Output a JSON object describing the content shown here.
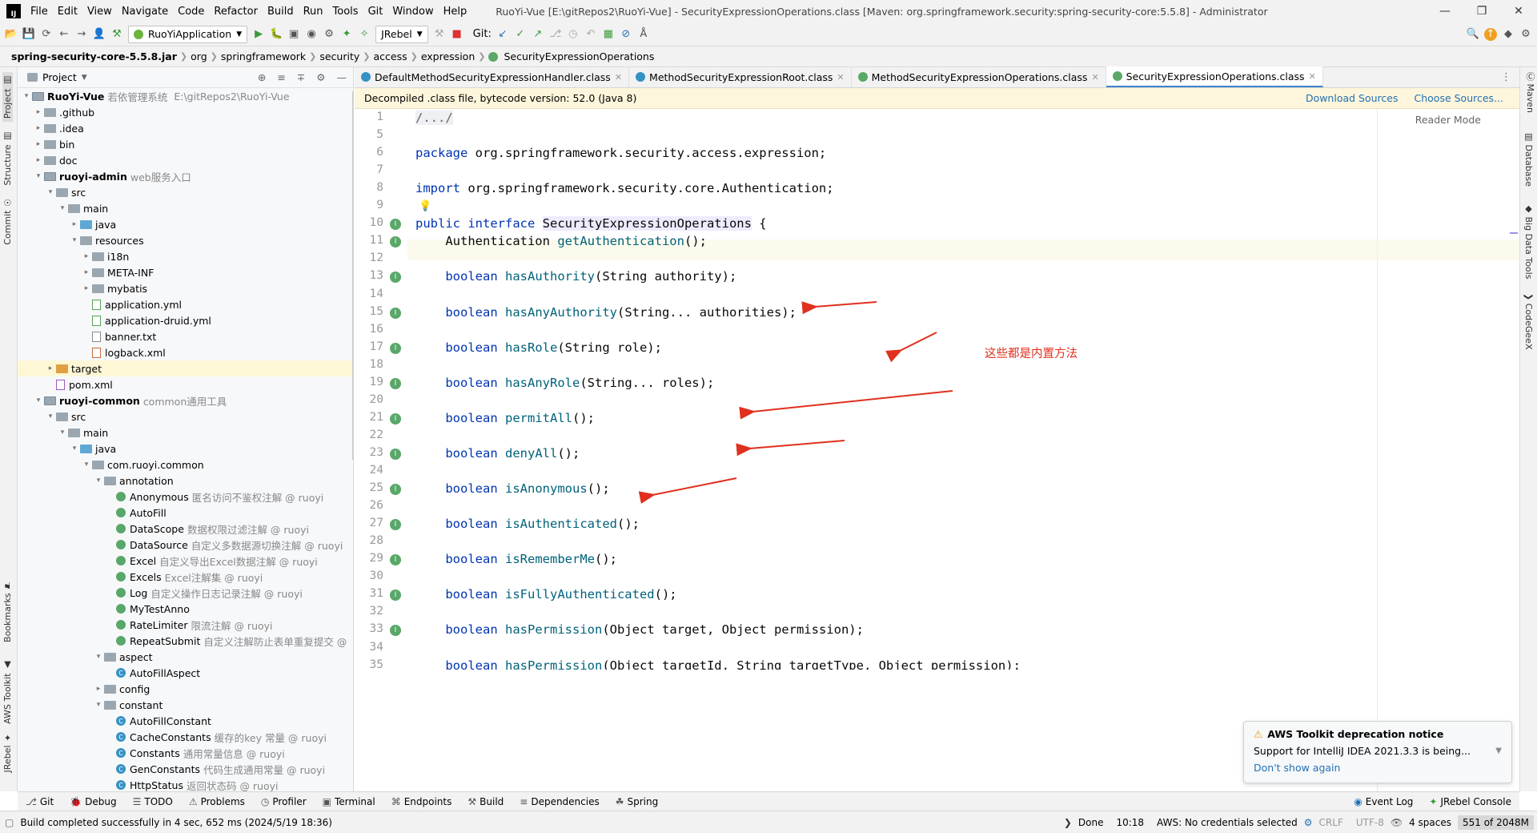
{
  "menu": {
    "logo": "IJ",
    "items": [
      "File",
      "Edit",
      "View",
      "Navigate",
      "Code",
      "Refactor",
      "Build",
      "Run",
      "Tools",
      "Git",
      "Window",
      "Help"
    ],
    "title": "RuoYi-Vue [E:\\gitRepos2\\RuoYi-Vue] - SecurityExpressionOperations.class [Maven: org.springframework.security:spring-security-core:5.5.8] - Administrator"
  },
  "toolbar": {
    "run_config": "RuoYiApplication",
    "jrebel": "JRebel",
    "git_label": "Git:"
  },
  "breadcrumb": [
    "spring-security-core-5.5.8.jar",
    "org",
    "springframework",
    "security",
    "access",
    "expression",
    "SecurityExpressionOperations"
  ],
  "left_strip": [
    "Project",
    "Structure",
    "Commit",
    "Bookmarks",
    "AWS Toolkit",
    "JRebel"
  ],
  "right_strip": [
    "Maven",
    "Database",
    "Big Data Tools",
    "CodeGeeX"
  ],
  "project": {
    "header": "Project",
    "tree": [
      {
        "label": "RuoYi-Vue",
        "note": "若依管理系统",
        "path": "E:\\gitRepos2\\RuoYi-Vue",
        "indent": 0,
        "arrow": "v",
        "icon": "mod",
        "bold": true
      },
      {
        "label": ".github",
        "indent": 1,
        "arrow": ">",
        "icon": "folder"
      },
      {
        "label": ".idea",
        "indent": 1,
        "arrow": ">",
        "icon": "folder"
      },
      {
        "label": "bin",
        "indent": 1,
        "arrow": ">",
        "icon": "folder"
      },
      {
        "label": "doc",
        "indent": 1,
        "arrow": ">",
        "icon": "folder"
      },
      {
        "label": "ruoyi-admin",
        "note": "web服务入口",
        "indent": 1,
        "arrow": "v",
        "icon": "mod",
        "bold": true
      },
      {
        "label": "src",
        "indent": 2,
        "arrow": "v",
        "icon": "folder"
      },
      {
        "label": "main",
        "indent": 3,
        "arrow": "v",
        "icon": "folder"
      },
      {
        "label": "java",
        "indent": 4,
        "arrow": ">",
        "icon": "blue"
      },
      {
        "label": "resources",
        "indent": 4,
        "arrow": "v",
        "icon": "folder"
      },
      {
        "label": "i18n",
        "indent": 5,
        "arrow": ">",
        "icon": "folder"
      },
      {
        "label": "META-INF",
        "indent": 5,
        "arrow": ">",
        "icon": "folder"
      },
      {
        "label": "mybatis",
        "indent": 5,
        "arrow": ">",
        "icon": "folder"
      },
      {
        "label": "application.yml",
        "indent": 5,
        "arrow": "",
        "icon": "yml"
      },
      {
        "label": "application-druid.yml",
        "indent": 5,
        "arrow": "",
        "icon": "yml"
      },
      {
        "label": "banner.txt",
        "indent": 5,
        "arrow": "",
        "icon": "txt"
      },
      {
        "label": "logback.xml",
        "indent": 5,
        "arrow": "",
        "icon": "xml"
      },
      {
        "label": "target",
        "indent": 2,
        "arrow": ">",
        "icon": "orange",
        "selected": true
      },
      {
        "label": "pom.xml",
        "indent": 2,
        "arrow": "",
        "icon": "pom"
      },
      {
        "label": "ruoyi-common",
        "note": "common通用工具",
        "indent": 1,
        "arrow": "v",
        "icon": "mod",
        "bold": true
      },
      {
        "label": "src",
        "indent": 2,
        "arrow": "v",
        "icon": "folder"
      },
      {
        "label": "main",
        "indent": 3,
        "arrow": "v",
        "icon": "folder"
      },
      {
        "label": "java",
        "indent": 4,
        "arrow": "v",
        "icon": "blue"
      },
      {
        "label": "com.ruoyi.common",
        "indent": 5,
        "arrow": "v",
        "icon": "folder"
      },
      {
        "label": "annotation",
        "indent": 6,
        "arrow": "v",
        "icon": "folder"
      },
      {
        "label": "Anonymous",
        "note": "匿名访问不鉴权注解 @ ruoyi",
        "indent": 7,
        "arrow": "",
        "icon": "annot"
      },
      {
        "label": "AutoFill",
        "indent": 7,
        "arrow": "",
        "icon": "annot"
      },
      {
        "label": "DataScope",
        "note": "数据权限过滤注解 @ ruoyi",
        "indent": 7,
        "arrow": "",
        "icon": "annot"
      },
      {
        "label": "DataSource",
        "note": "自定义多数据源切换注解 @ ruoyi",
        "indent": 7,
        "arrow": "",
        "icon": "annot"
      },
      {
        "label": "Excel",
        "note": "自定义导出Excel数据注解 @ ruoyi",
        "indent": 7,
        "arrow": "",
        "icon": "annot"
      },
      {
        "label": "Excels",
        "note": "Excel注解集 @ ruoyi",
        "indent": 7,
        "arrow": "",
        "icon": "annot"
      },
      {
        "label": "Log",
        "note": "自定义操作日志记录注解 @ ruoyi",
        "indent": 7,
        "arrow": "",
        "icon": "annot"
      },
      {
        "label": "MyTestAnno",
        "indent": 7,
        "arrow": "",
        "icon": "annot"
      },
      {
        "label": "RateLimiter",
        "note": "限流注解 @ ruoyi",
        "indent": 7,
        "arrow": "",
        "icon": "annot"
      },
      {
        "label": "RepeatSubmit",
        "note": "自定义注解防止表单重复提交 @",
        "indent": 7,
        "arrow": "",
        "icon": "annot"
      },
      {
        "label": "aspect",
        "indent": 6,
        "arrow": "v",
        "icon": "folder"
      },
      {
        "label": "AutoFillAspect",
        "indent": 7,
        "arrow": "",
        "icon": "cls"
      },
      {
        "label": "config",
        "indent": 6,
        "arrow": ">",
        "icon": "folder"
      },
      {
        "label": "constant",
        "indent": 6,
        "arrow": "v",
        "icon": "folder"
      },
      {
        "label": "AutoFillConstant",
        "indent": 7,
        "arrow": "",
        "icon": "cls"
      },
      {
        "label": "CacheConstants",
        "note": "缓存的key 常量 @ ruoyi",
        "indent": 7,
        "arrow": "",
        "icon": "cls"
      },
      {
        "label": "Constants",
        "note": "通用常量信息 @ ruoyi",
        "indent": 7,
        "arrow": "",
        "icon": "cls"
      },
      {
        "label": "GenConstants",
        "note": "代码生成通用常量 @ ruoyi",
        "indent": 7,
        "arrow": "",
        "icon": "cls"
      },
      {
        "label": "HttpStatus",
        "note": "返回状态码 @ ruoyi",
        "indent": 7,
        "arrow": "",
        "icon": "cls"
      }
    ]
  },
  "tabs": [
    {
      "label": "DefaultMethodSecurityExpressionHandler.class",
      "active": false
    },
    {
      "label": "MethodSecurityExpressionRoot.class",
      "active": false
    },
    {
      "label": "MethodSecurityExpressionOperations.class",
      "active": false
    },
    {
      "label": "SecurityExpressionOperations.class",
      "active": true
    }
  ],
  "banner": {
    "text": "Decompiled .class file, bytecode version: 52.0 (Java 8)",
    "download": "Download Sources",
    "choose": "Choose Sources..."
  },
  "editor": {
    "reader_mode": "Reader Mode",
    "lines": [
      {
        "n": "1",
        "code": "/.../",
        "kind": "fold"
      },
      {
        "n": "5",
        "code": ""
      },
      {
        "n": "6",
        "code": "package org.springframework.security.access.expression;",
        "kind": "kw1"
      },
      {
        "n": "7",
        "code": ""
      },
      {
        "n": "8",
        "code": "import org.springframework.security.core.Authentication;",
        "kind": "kw1"
      },
      {
        "n": "9",
        "code": "",
        "bulb": true
      },
      {
        "n": "10",
        "code": "public interface SecurityExpressionOperations {",
        "kind": "iface",
        "gut": true
      },
      {
        "n": "11",
        "code": "    Authentication getAuthentication();",
        "kind": "m",
        "gut": true,
        "type": "Authentication",
        "name": "getAuthentication",
        "args": "();"
      },
      {
        "n": "12",
        "code": ""
      },
      {
        "n": "13",
        "code": "",
        "kind": "m",
        "gut": true,
        "type": "boolean",
        "name": "hasAuthority",
        "args": "(String authority);"
      },
      {
        "n": "14",
        "code": ""
      },
      {
        "n": "15",
        "code": "",
        "kind": "m",
        "gut": true,
        "type": "boolean",
        "name": "hasAnyAuthority",
        "args": "(String... authorities);"
      },
      {
        "n": "16",
        "code": ""
      },
      {
        "n": "17",
        "code": "",
        "kind": "m",
        "gut": true,
        "type": "boolean",
        "name": "hasRole",
        "args": "(String role);"
      },
      {
        "n": "18",
        "code": ""
      },
      {
        "n": "19",
        "code": "",
        "kind": "m",
        "gut": true,
        "type": "boolean",
        "name": "hasAnyRole",
        "args": "(String... roles);"
      },
      {
        "n": "20",
        "code": ""
      },
      {
        "n": "21",
        "code": "",
        "kind": "m",
        "gut": true,
        "type": "boolean",
        "name": "permitAll",
        "args": "();"
      },
      {
        "n": "22",
        "code": ""
      },
      {
        "n": "23",
        "code": "",
        "kind": "m",
        "gut": true,
        "type": "boolean",
        "name": "denyAll",
        "args": "();"
      },
      {
        "n": "24",
        "code": ""
      },
      {
        "n": "25",
        "code": "",
        "kind": "m",
        "gut": true,
        "type": "boolean",
        "name": "isAnonymous",
        "args": "();"
      },
      {
        "n": "26",
        "code": ""
      },
      {
        "n": "27",
        "code": "",
        "kind": "m",
        "gut": true,
        "type": "boolean",
        "name": "isAuthenticated",
        "args": "();"
      },
      {
        "n": "28",
        "code": ""
      },
      {
        "n": "29",
        "code": "",
        "kind": "m",
        "gut": true,
        "type": "boolean",
        "name": "isRememberMe",
        "args": "();"
      },
      {
        "n": "30",
        "code": ""
      },
      {
        "n": "31",
        "code": "",
        "kind": "m",
        "gut": true,
        "type": "boolean",
        "name": "isFullyAuthenticated",
        "args": "();"
      },
      {
        "n": "32",
        "code": ""
      },
      {
        "n": "33",
        "code": "",
        "kind": "m",
        "gut": true,
        "type": "boolean",
        "name": "hasPermission",
        "args": "(Object target, Object permission);"
      },
      {
        "n": "34",
        "code": ""
      },
      {
        "n": "35",
        "code": "    boolean hasPermission(Object targetId, String targetType, Object permission);",
        "kind": "cut"
      }
    ]
  },
  "annotation_note": "这些都是内置方法",
  "notification": {
    "title": "AWS Toolkit deprecation notice",
    "body": "Support for IntelliJ IDEA 2021.3.3 is being...",
    "link": "Don't show again"
  },
  "tool_windows": [
    "Git",
    "Debug",
    "TODO",
    "Problems",
    "Profiler",
    "Terminal",
    "Endpoints",
    "Build",
    "Dependencies",
    "Spring"
  ],
  "tool_windows_right": [
    "Event Log",
    "JRebel Console"
  ],
  "status": {
    "message": "Build completed successfully in 4 sec, 652 ms (2024/5/19 18:36)",
    "done": "Done",
    "position": "10:18",
    "aws": "AWS: No credentials selected",
    "line_sep": "CRLF",
    "encoding": "UTF-8",
    "indent": "4 spaces",
    "memory_used": "551",
    "memory_total": "of 2048M"
  },
  "colors": {
    "accent": "#4083c9",
    "keyword": "#0033b3",
    "method": "#00627a",
    "arrow": "#e0301e"
  }
}
